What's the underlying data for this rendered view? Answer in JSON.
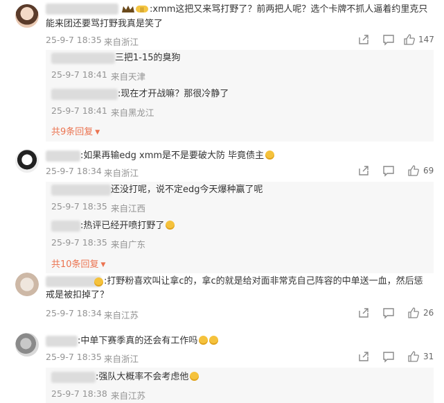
{
  "comments": [
    {
      "text_line1": ":xmm这把又来骂打野了？前两把人呢？选个卡牌不抓人逼着约里克只",
      "text_line2": "能来团还要骂打野我真是笑了",
      "date": "25-9-7 18:35",
      "location": "来自浙江",
      "likes": "147",
      "replies": [
        {
          "text": "三把1-15的臭狗",
          "date": "25-9-7 18:41",
          "location": "来自天津"
        },
        {
          "text": ":现在才开战嘛？那很冷静了",
          "date": "25-9-7 18:41",
          "location": "来自黑龙江"
        }
      ],
      "more_replies": "共9条回复"
    },
    {
      "text_line1": ":如果再输edg xmm是不是要破大防 毕竟债主",
      "date": "25-9-7 18:34",
      "location": "来自浙江",
      "likes": "69",
      "replies": [
        {
          "text": "还没打呢，说不定edg今天爆种赢了呢",
          "date": "25-9-7 18:35",
          "location": "来自江西"
        },
        {
          "text": ":热评已经开喷打野了",
          "date": "25-9-7 18:35",
          "location": "来自广东"
        }
      ],
      "more_replies": "共10条回复"
    },
    {
      "text_line1": ":打野粉喜欢叫让拿c的，拿c的就是给对面非常克自己阵容的中单送一血，然后惩",
      "text_line2": "戒是被扣掉了？",
      "date": "25-9-7 18:34",
      "location": "来自江苏",
      "likes": "26"
    },
    {
      "text_line1": ":中单下赛季真的还会有工作吗",
      "date": "25-9-7 18:35",
      "location": "来自浙江",
      "likes": "31",
      "replies": [
        {
          "text": ":强队大概率不会考虑他",
          "date": "25-9-7 18:38",
          "location": "来自江苏"
        }
      ]
    }
  ],
  "icons": [
    "share-icon",
    "comment-icon",
    "like-icon",
    "emoji-icon",
    "vip-crown-icon"
  ],
  "colors": {
    "accent": "#eb7350",
    "meta": "#939393",
    "reply_bg": "#f7f7f7"
  }
}
